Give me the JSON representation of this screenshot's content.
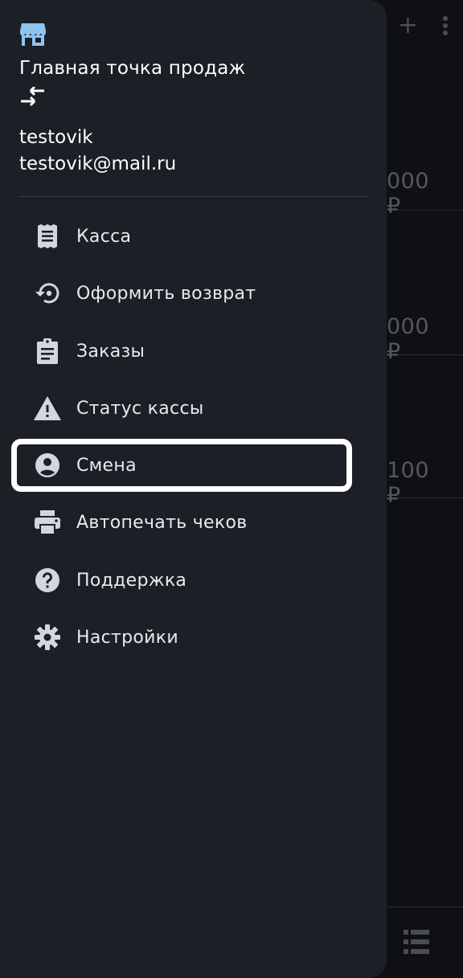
{
  "background": {
    "prices": [
      "000 ₽",
      "000 ₽",
      "100 ₽"
    ],
    "icons": [
      "add-icon",
      "more-vert-icon",
      "list-icon"
    ]
  },
  "drawer": {
    "store_name": "Главная точка продаж",
    "user": {
      "name": "testovik",
      "email": "testovik@mail.ru"
    },
    "menu": [
      {
        "label": "Касса",
        "icon": "receipt-icon"
      },
      {
        "label": "Оформить возврат",
        "icon": "restore-icon"
      },
      {
        "label": "Заказы",
        "icon": "clipboard-icon"
      },
      {
        "label": "Статус кассы",
        "icon": "warning-icon"
      },
      {
        "label": "Смена",
        "icon": "account-circle-icon",
        "selected": true
      },
      {
        "label": "Автопечать чеков",
        "icon": "printer-icon"
      },
      {
        "label": "Поддержка",
        "icon": "help-icon"
      },
      {
        "label": "Настройки",
        "icon": "gear-icon"
      }
    ]
  },
  "colors": {
    "drawer_bg": "#1c1f26",
    "screen_bg": "#0f1013",
    "icon_grey": "#d3d6dc",
    "store_icon_blue": "#8fc3f0",
    "highlight": "#ffffff"
  }
}
